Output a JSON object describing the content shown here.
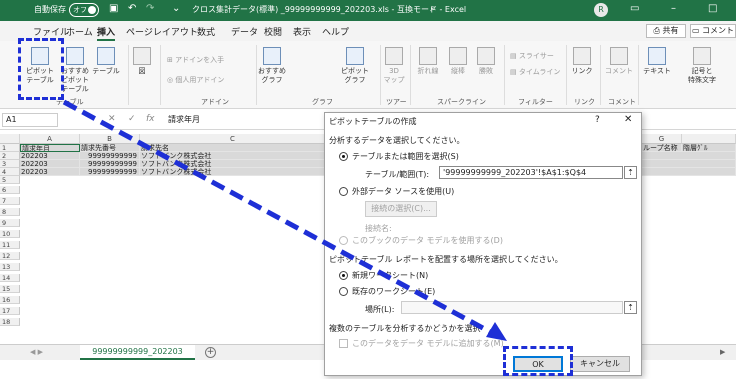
{
  "titlebar": {
    "autosave_label": "自動保存",
    "autosave_state": "オフ",
    "title": "クロス集計データ(標準) _99999999999_202203.xls - 互換モード - Excel",
    "avatar": "R"
  },
  "menu": {
    "tabs": [
      "ファイル",
      "ホーム",
      "挿入",
      "ページレイアウト",
      "数式",
      "データ",
      "校閲",
      "表示",
      "ヘルプ"
    ],
    "share": "共有",
    "comment": "コメント"
  },
  "ribbon": {
    "pivot_table": "ピボット\nテーブル",
    "recommended_pivot": "おすすめ\nピボットテーブル",
    "table": "テーブル",
    "figure": "図",
    "get_addins": "アドインを入手",
    "personal_addins": "個人用アドイン",
    "recommended_charts": "おすすめ\nグラフ",
    "pivot_chart": "ピボットグラフ",
    "map3d": "3D\nマップ",
    "line": "折れ線",
    "column": "縦棒",
    "winloss": "勝敗",
    "slicer": "スライサー",
    "timeline": "タイムライン",
    "link": "リンク",
    "comment_btn": "コメント",
    "text": "テキスト",
    "symbol": "記号と\n特殊文字",
    "groups": {
      "table": "テーブル",
      "addin": "アドイン",
      "chart": "グラフ",
      "tour": "ツアー",
      "sparkline": "スパークライン",
      "filter": "フィルター",
      "link": "リンク",
      "comment": "コメント"
    }
  },
  "formula_bar": {
    "name_box": "A1",
    "value": "請求年月"
  },
  "sheet": {
    "columns": [
      "A",
      "B",
      "C",
      "G"
    ],
    "rows": [
      "1",
      "2",
      "3",
      "4",
      "5",
      "6",
      "7",
      "8",
      "9",
      "10",
      "11",
      "12",
      "13",
      "14",
      "15",
      "16",
      "17",
      "18"
    ],
    "header_row": [
      "請求年月",
      "請求先番号",
      "請求先名"
    ],
    "data_rows": [
      [
        "202203",
        "99999999999",
        "ソフトバンク株式会社"
      ],
      [
        "202203",
        "99999999999",
        "ソフトバンク株式会社"
      ],
      [
        "202203",
        "99999999999",
        "ソフトバンク株式会社"
      ]
    ],
    "right_headers": [
      "ループ名称",
      "階層ｸﾞﾙ"
    ],
    "tab_name": "99999999999_202203"
  },
  "dialog": {
    "title": "ピボットテーブルの作成",
    "help": "?",
    "section1": "分析するデータを選択してください。",
    "opt_table": "テーブルまたは範囲を選択(S)",
    "range_label": "テーブル/範囲(T):",
    "range_value": "'99999999999_202203'!$A$1:$Q$4",
    "opt_external": "外部データ ソースを使用(U)",
    "choose_conn": "接続の選択(C)...",
    "conn_name": "接続名:",
    "use_model": "このブックのデータ モデルを使用する(D)",
    "section2": "ピボットテーブル レポートを配置する場所を選択してください。",
    "opt_new": "新規ワークシート(N)",
    "opt_existing": "既存のワークシート(E)",
    "location_label": "場所(L):",
    "section3": "複数のテーブルを分析するかどうかを選択",
    "add_model": "このデータをデータ モデルに追加する(M)",
    "ok": "OK",
    "cancel": "キャンセル"
  }
}
